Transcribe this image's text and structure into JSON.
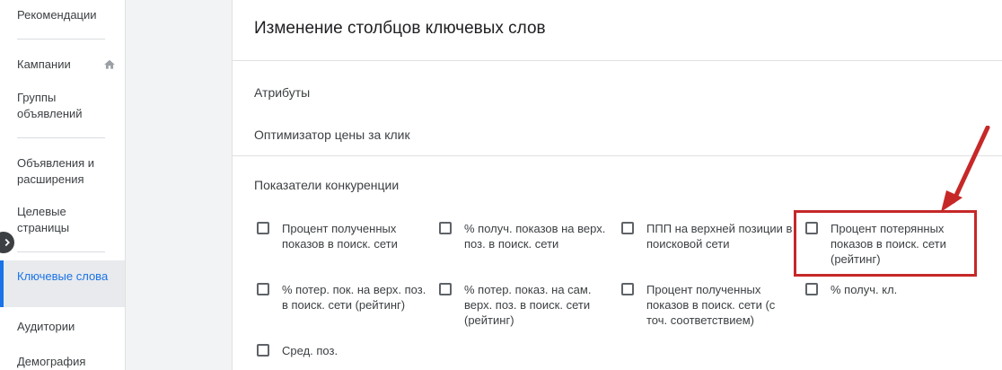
{
  "sidebar": {
    "items": [
      {
        "label": "Рекомендации"
      },
      {
        "label": "Кампании"
      },
      {
        "label": "Группы объявлений"
      },
      {
        "label": "Объявления и расширения"
      },
      {
        "label": "Целевые страницы"
      },
      {
        "label": "Ключевые слова"
      },
      {
        "label": "Аудитории"
      },
      {
        "label": "Демография"
      }
    ],
    "active_item": "Ключевые слова",
    "home_icon": "home-icon",
    "collapse_icon": "chevron-right-icon"
  },
  "panel": {
    "title": "Изменение столбцов ключевых слов",
    "sections": [
      {
        "label": "Атрибуты"
      },
      {
        "label": "Оптимизатор цены за клик"
      },
      {
        "label": "Показатели конкуренции"
      }
    ],
    "checkboxes": [
      {
        "label": "Процент полученных показов в поиск. сети",
        "checked": false
      },
      {
        "label": "% получ. показов на верх. поз. в поиск. сети",
        "checked": false
      },
      {
        "label": "ППП на верхней позиции в поисковой сети",
        "checked": false
      },
      {
        "label": "Процент потерянных показов в поиск. сети (рейтинг)",
        "checked": false
      },
      {
        "label": "% потер. пок. на верх. поз. в поиск. сети (рейтинг)",
        "checked": false
      },
      {
        "label": "% потер. показ. на сам. верх. поз. в поиск. сети (рейтинг)",
        "checked": false
      },
      {
        "label": "Процент полученных показов в поиск. сети (с точ. соответствием)",
        "checked": false
      },
      {
        "label": "% получ. кл.",
        "checked": false
      },
      {
        "label": "Сред. поз.",
        "checked": false
      }
    ]
  },
  "colors": {
    "accent": "#1a73e8",
    "annotation": "#c62828"
  }
}
